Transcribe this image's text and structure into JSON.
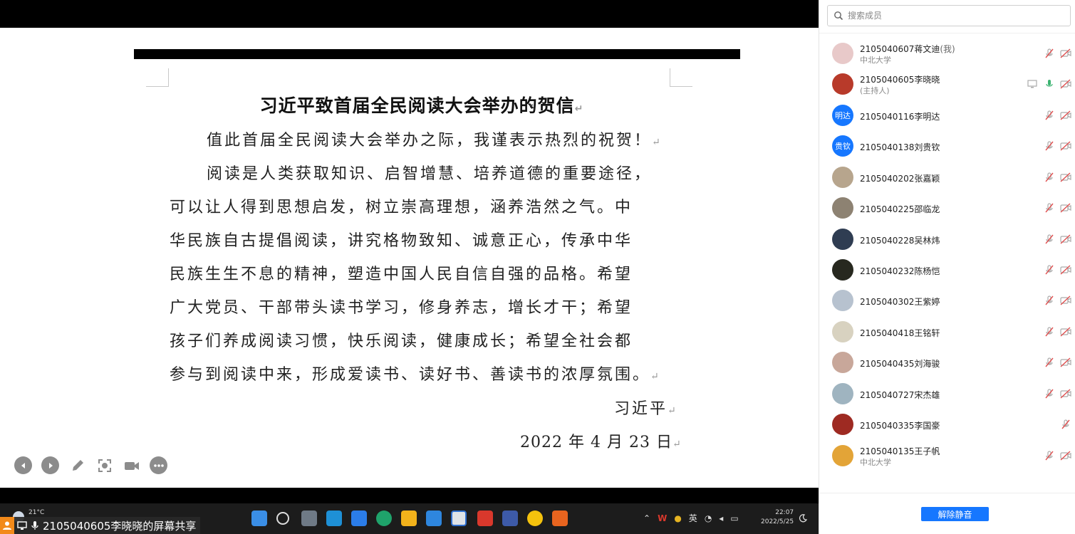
{
  "letter": {
    "title": "习近平致首届全民阅读大会举办的贺信",
    "lines": [
      "值此首届全民阅读大会举办之际，我谨表示热烈的祝贺！",
      "阅读是人类获取知识、启智增慧、培养道德的重要途径，",
      "可以让人得到思想启发，树立崇高理想，涵养浩然之气。中",
      "华民族自古提倡阅读，讲究格物致知、诚意正心，传承中华",
      "民族生生不息的精神，塑造中国人民自信自强的品格。希望",
      "广大党员、干部带头读书学习，修身养志，增长才干；希望",
      "孩子们养成阅读习惯，快乐阅读，健康成长；希望全社会都",
      "参与到阅读中来，形成爱读书、读好书、善读书的浓厚氛围。"
    ],
    "signature": "习近平",
    "date": "2022 年 4 月 23 日",
    "paragraph_mark": "↵"
  },
  "slide_tools": [
    {
      "name": "prev-slide-icon"
    },
    {
      "name": "next-slide-icon"
    },
    {
      "name": "pen-icon"
    },
    {
      "name": "screenshot-icon"
    },
    {
      "name": "camera-icon"
    },
    {
      "name": "more-icon"
    }
  ],
  "taskbar": {
    "weather": "21°C",
    "input_method": "英",
    "time": "22:07",
    "date": "2022/5/25"
  },
  "share_label": "2105040605李晓晓的屏幕共享",
  "panel": {
    "search_placeholder": "搜索成员",
    "unmute_all": "解除静音",
    "members": [
      {
        "name": "2105040607蒋文迪",
        "tag": "(我)",
        "sub": "中北大学",
        "avatar_color": "#e8c9c9"
      },
      {
        "name": "2105040605李晓晓",
        "tag": "",
        "sub": "(主持人)",
        "avatar_color": "#b83a2a"
      },
      {
        "name": "2105040116李明达",
        "tag": "",
        "sub": "",
        "avatar_text": "明达",
        "avatar_color": "#1677ff"
      },
      {
        "name": "2105040138刘贵钦",
        "tag": "",
        "sub": "",
        "avatar_text": "贵钦",
        "avatar_color": "#1677ff"
      },
      {
        "name": "2105040202张嘉颖",
        "tag": "",
        "sub": "",
        "avatar_color": "#b7a58d"
      },
      {
        "name": "2105040225邵临龙",
        "tag": "",
        "sub": "",
        "avatar_color": "#8d8272"
      },
      {
        "name": "2105040228吴林炜",
        "tag": "",
        "sub": "",
        "avatar_color": "#2f3d52"
      },
      {
        "name": "2105040232陈杨恺",
        "tag": "",
        "sub": "",
        "avatar_color": "#27281f"
      },
      {
        "name": "2105040302王紫婷",
        "tag": "",
        "sub": "",
        "avatar_color": "#b7c2cf"
      },
      {
        "name": "2105040418王铭轩",
        "tag": "",
        "sub": "",
        "avatar_color": "#d8d2c0"
      },
      {
        "name": "2105040435刘海骏",
        "tag": "",
        "sub": "",
        "avatar_color": "#c8a79a"
      },
      {
        "name": "2105040727宋杰雄",
        "tag": "",
        "sub": "",
        "avatar_color": "#9fb4c0"
      },
      {
        "name": "2105040335李国豪",
        "tag": "",
        "sub": "",
        "avatar_color": "#9e2a22"
      },
      {
        "name": "2105040135王子帆",
        "tag": "",
        "sub": "中北大学",
        "avatar_color": "#e3a437"
      }
    ]
  },
  "colors": {
    "accent": "#1677ff",
    "muted_red": "#e05050",
    "mic_green": "#3cb371"
  }
}
